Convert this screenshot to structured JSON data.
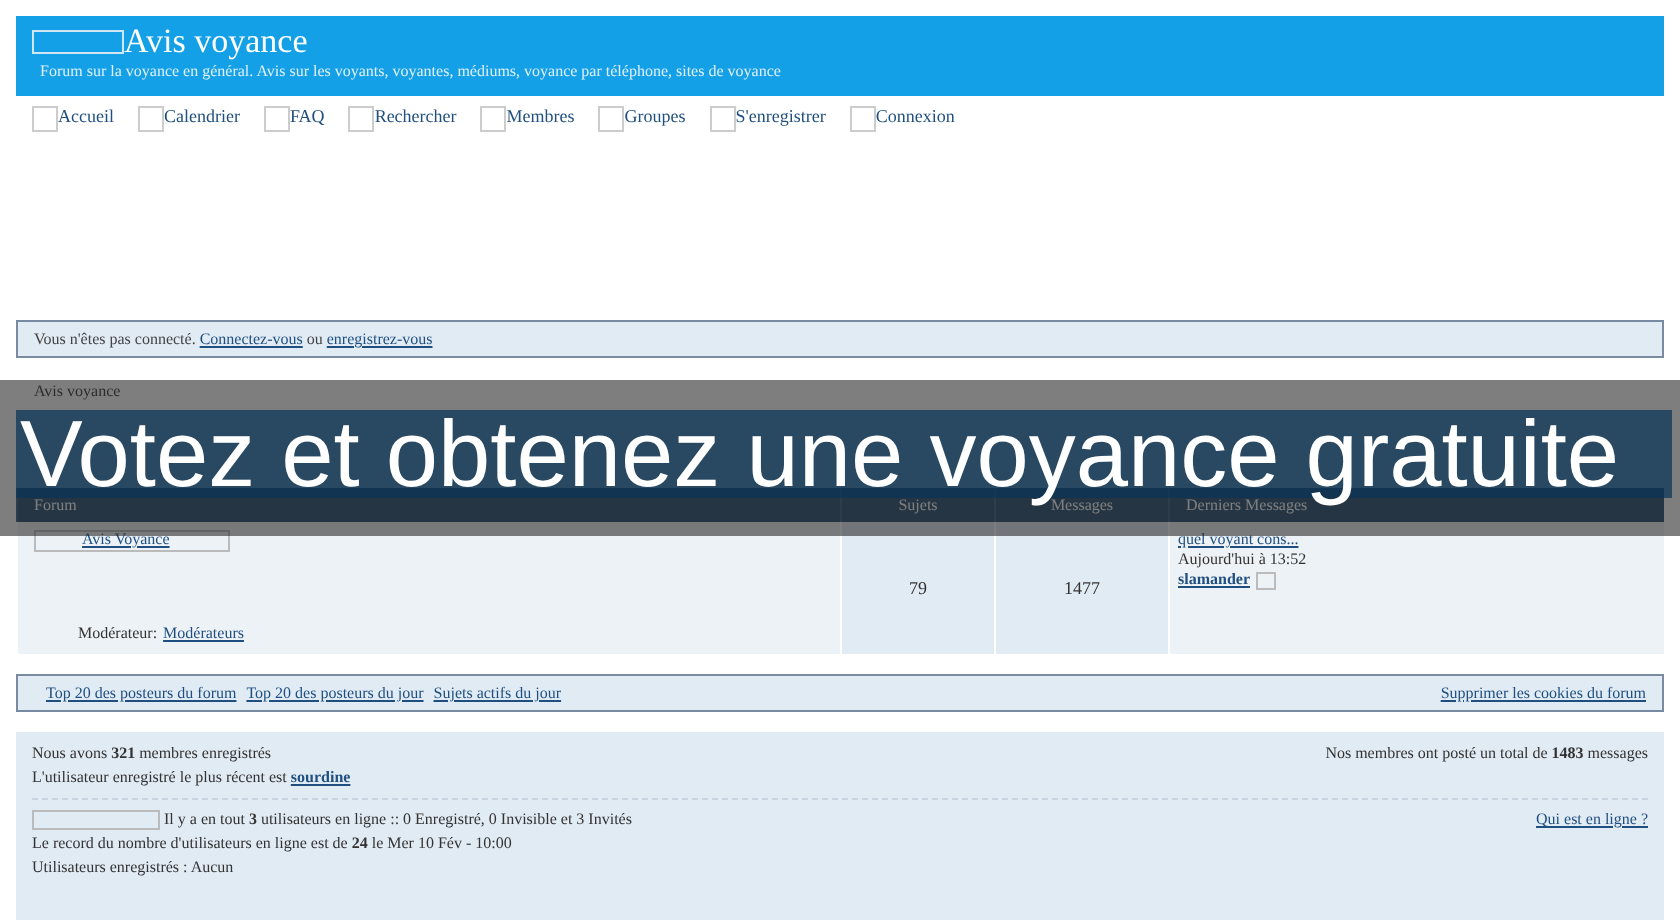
{
  "header": {
    "title": "Avis voyance",
    "subtitle": "Forum sur la voyance en général. Avis sur les voyants, voyantes, médiums, voyance par téléphone, sites de voyance"
  },
  "nav": [
    {
      "label": "Accueil"
    },
    {
      "label": "Calendrier"
    },
    {
      "label": "FAQ"
    },
    {
      "label": "Rechercher"
    },
    {
      "label": "Membres"
    },
    {
      "label": "Groupes"
    },
    {
      "label": "S'enregistrer"
    },
    {
      "label": "Connexion"
    }
  ],
  "notice": {
    "text": "Vous n'êtes pas connecté.",
    "login_link": "Connectez-vous",
    "joiner": "ou",
    "register_link": "enregistrez-vous"
  },
  "breadcrumb": "Avis voyance",
  "table": {
    "columns": [
      "Forum",
      "Sujets",
      "Messages",
      "Derniers Messages"
    ],
    "rows": [
      {
        "forum": "Avis Voyance",
        "moderator_label": "Modérateur:",
        "moderator": "Modérateurs",
        "topics": "79",
        "posts": "1477",
        "last_post": {
          "title": "quel voyant cons...",
          "time": "Aujourd'hui à 13:52",
          "author": "slamander"
        }
      }
    ]
  },
  "footer_links": {
    "left": [
      "Top 20 des posteurs du forum",
      "Top 20 des posteurs du jour",
      "Sujets actifs du jour"
    ],
    "right": "Supprimer les cookies du forum"
  },
  "stats": {
    "members": "Nous avons **321** membres enregistrés",
    "newest_label": "L'utilisateur enregistré le plus récent est",
    "newest_user": "sourdine",
    "total": "Nos membres ont posté un total de **1483** messages"
  },
  "online": {
    "summary": "Il y a en tout **3** utilisateurs en ligne :: 0 Enregistré, 0 Invisible et 3 Invités",
    "who_link": "Qui est en ligne ?",
    "record": "Le record du nombre d'utilisateurs en ligne est de **24** le Mer 10 Fév - 10:00",
    "registered": "Utilisateurs enregistrés : Aucun"
  },
  "banner": {
    "text": "Votez et obtenez une voyance gratuite"
  }
}
